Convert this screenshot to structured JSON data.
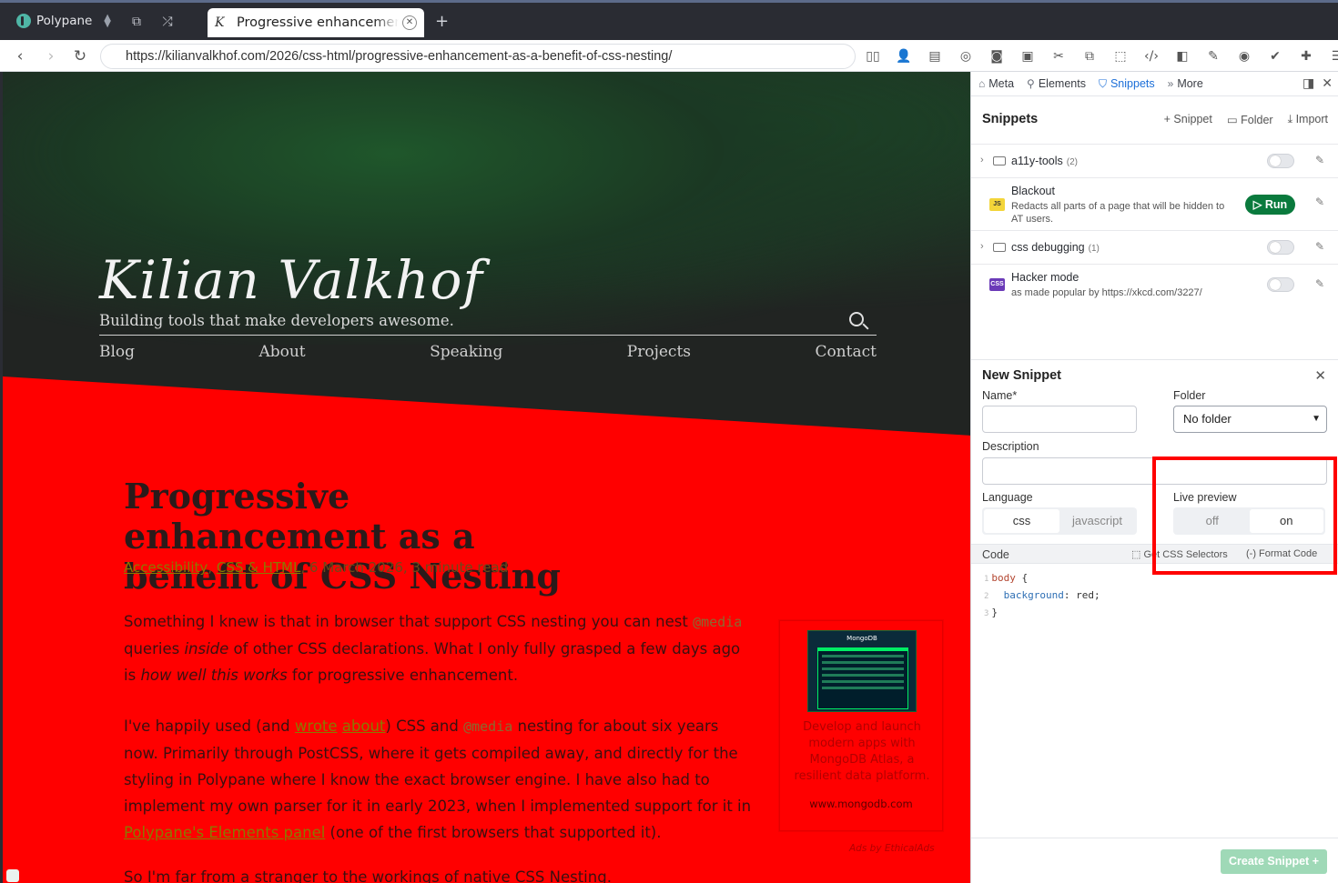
{
  "browser": {
    "app_name": "Polypane",
    "tab_title": "Progressive enhancement as a benefit of CSS Nesting",
    "url": "https://kilianvalkhof.com/2026/css-html/progressive-enhancement-as-a-benefit-of-css-nesting/"
  },
  "site": {
    "name": "Kilian Valkhof",
    "tagline": "Building tools that make developers awesome.",
    "nav": [
      "Blog",
      "About",
      "Speaking",
      "Projects",
      "Contact"
    ]
  },
  "article": {
    "title": "Progressive enhancement as a benefit of CSS Nesting",
    "meta_link1": "Accessibility",
    "meta_link2": "CSS & HTML",
    "meta_rest": ", 6 March 2026, 3 minute read",
    "p1_a": "Something I knew is that in browser that support CSS nesting you can nest ",
    "p1_code": "@media",
    "p1_b": " queries ",
    "p1_em": "inside",
    "p1_c": " of other CSS declarations. What I only fully grasped a few days ago is ",
    "p1_em2": "how well this works",
    "p1_d": " for progressive enhancement.",
    "p2_a": "I've happily used (and ",
    "p2_link1": "wrote",
    "p2_link2": "about",
    "p2_b": ") CSS and ",
    "p2_code": "@media",
    "p2_c": " nesting for about six years now. Primarily through PostCSS, where it gets compiled away, and directly for the styling in Polypane where I know the exact browser engine. I have also had to implement my own parser for it in early 2023, when I implemented support for it in ",
    "p2_link3": "Polypane's Elements panel",
    "p2_d": " (one of the first browsers that supported it).",
    "p3": "So I'm far from a stranger to the workings of native CSS Nesting."
  },
  "ad": {
    "brand": "MongoDB",
    "text": "Develop and launch modern apps with MongoDB Atlas, a resilient data platform.",
    "link": "www.mongodb.com",
    "credit": "Ads by EthicalAds"
  },
  "panel": {
    "tabs": [
      "Meta",
      "Elements",
      "Snippets",
      "More"
    ],
    "heading": "Snippets",
    "actions": [
      "Snippet",
      "Folder",
      "Import"
    ],
    "items": [
      {
        "name": "a11y-tools",
        "count": "(2)"
      },
      {
        "name": "Blackout",
        "badge": "JS",
        "desc": "Redacts all parts of a page that will be hidden to AT users.",
        "run": "Run"
      },
      {
        "name": "css debugging",
        "count": "(1)"
      },
      {
        "name": "Hacker mode",
        "badge": "CSS",
        "desc": "as made popular by https://xkcd.com/3227/"
      }
    ],
    "new_snippet": {
      "heading": "New Snippet",
      "name_label": "Name*",
      "folder_label": "Folder",
      "folder_value": "No folder",
      "description_label": "Description",
      "language_label": "Language",
      "language_options": [
        "css",
        "javascript"
      ],
      "live_label": "Live preview",
      "live_options": [
        "off",
        "on"
      ],
      "code_label": "Code",
      "get_selectors": "Get CSS Selectors",
      "format_code": "Format Code",
      "code_lines": [
        "1",
        "2",
        "3"
      ],
      "code_selector": "body",
      "code_prop": "background",
      "code_value": "red;",
      "create_label": "Create Snippet"
    }
  }
}
